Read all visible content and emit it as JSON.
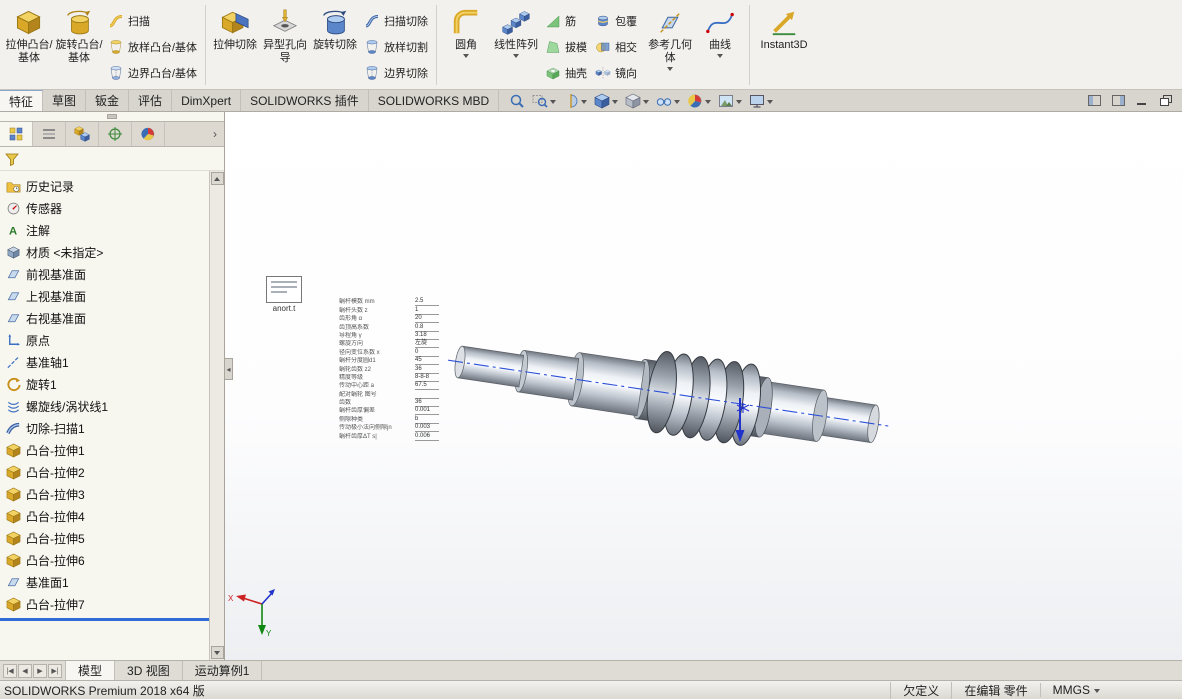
{
  "ribbon": {
    "groups": [
      {
        "big": [
          {
            "label": "拉伸凸台/基体"
          },
          {
            "label": "旋转凸台/基体"
          }
        ],
        "small": [
          {
            "label": "扫描"
          },
          {
            "label": "放样凸台/基体"
          },
          {
            "label": "边界凸台/基体"
          }
        ]
      },
      {
        "big": [
          {
            "label": "拉伸切除"
          },
          {
            "label": "异型孔向导"
          },
          {
            "label": "旋转切除"
          }
        ],
        "small": [
          {
            "label": "扫描切除"
          },
          {
            "label": "放样切割"
          },
          {
            "label": "边界切除"
          }
        ]
      },
      {
        "big": [
          {
            "label": "圆角"
          },
          {
            "label": "线性阵列"
          }
        ],
        "small": [
          {
            "label": "筋"
          },
          {
            "label": "拔模"
          },
          {
            "label": "抽壳"
          }
        ],
        "small2": [
          {
            "label": "包覆"
          },
          {
            "label": "相交"
          },
          {
            "label": "镜向"
          }
        ]
      },
      {
        "big": [
          {
            "label": "参考几何体"
          },
          {
            "label": "曲线"
          }
        ]
      },
      {
        "big": [
          {
            "label": "Instant3D"
          }
        ]
      }
    ]
  },
  "tabs": [
    {
      "label": "特征"
    },
    {
      "label": "草图"
    },
    {
      "label": "钣金"
    },
    {
      "label": "评估"
    },
    {
      "label": "DimXpert"
    },
    {
      "label": "SOLIDWORKS 插件"
    },
    {
      "label": "SOLIDWORKS MBD"
    }
  ],
  "hud_icons": [
    "zoom-fit",
    "zoom-to-area",
    "section-view",
    "view-orientation",
    "display-style",
    "hide-show-items",
    "edit-appearance",
    "apply-scene",
    "view-settings"
  ],
  "tree": {
    "items": [
      {
        "label": "历史记录"
      },
      {
        "label": "传感器"
      },
      {
        "label": "注解"
      },
      {
        "label": "材质 <未指定>"
      },
      {
        "label": "前视基准面"
      },
      {
        "label": "上视基准面"
      },
      {
        "label": "右视基准面"
      },
      {
        "label": "原点"
      },
      {
        "label": "基准轴1"
      },
      {
        "label": "旋转1"
      },
      {
        "label": "螺旋线/涡状线1"
      },
      {
        "label": "切除-扫描1"
      },
      {
        "label": "凸台-拉伸1"
      },
      {
        "label": "凸台-拉伸2"
      },
      {
        "label": "凸台-拉伸3"
      },
      {
        "label": "凸台-拉伸4"
      },
      {
        "label": "凸台-拉伸5"
      },
      {
        "label": "凸台-拉伸6"
      },
      {
        "label": "基准面1"
      },
      {
        "label": "凸台-拉伸7"
      }
    ]
  },
  "viewport": {
    "note_label": "anort.t",
    "triad": {
      "x": "X",
      "y": "Y"
    },
    "params": {
      "rows": [
        {
          "label": "蜗杆模数 mm",
          "value": "2.5"
        },
        {
          "label": "蜗杆头数 z",
          "value": "1"
        },
        {
          "label": "齿形角 α",
          "value": "20"
        },
        {
          "label": "齿顶高系数",
          "value": "0.8"
        },
        {
          "label": "导程角 γ",
          "value": "3.18"
        },
        {
          "label": "螺旋方向",
          "value": "左旋"
        },
        {
          "label": "径向变位系数 x",
          "value": "0"
        },
        {
          "label": "蜗杆分度圆d1",
          "value": "45"
        },
        {
          "label": "蜗轮齿数 z2",
          "value": "36"
        },
        {
          "label": "精度等级",
          "value": "8-8-8"
        },
        {
          "label": "传动中心距 a",
          "value": "67.5"
        },
        {
          "label": "配对蜗轮 图号",
          "value": ""
        },
        {
          "label": "齿数",
          "value": "36"
        },
        {
          "label": "蜗杆齿厚偏差",
          "value": "0.001"
        },
        {
          "label": "侧隙种类",
          "value": "b"
        },
        {
          "label": "传动极小法向侧隙jn",
          "value": "0.003"
        },
        {
          "label": "蜗杆齿厚ΔT s|",
          "value": "0.006"
        }
      ]
    }
  },
  "bottom_tabs": [
    {
      "label": "模型"
    },
    {
      "label": "3D 视图"
    },
    {
      "label": "运动算例1"
    }
  ],
  "status": {
    "app": "SOLIDWORKS Premium 2018 x64 版",
    "state": "欠定义",
    "mode": "在编辑 零件",
    "units": "MMGS"
  }
}
